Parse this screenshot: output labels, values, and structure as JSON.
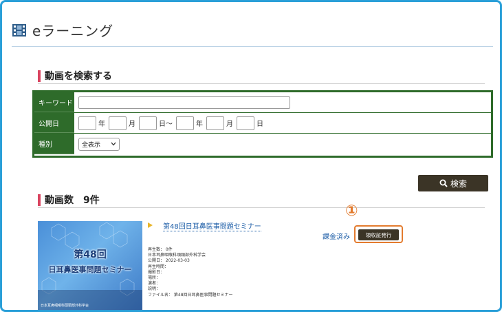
{
  "page": {
    "title": "eラーニング"
  },
  "search_section": {
    "heading": "動画を検索する",
    "form": {
      "keyword_label": "キーワード",
      "keyword_value": "",
      "date_label": "公開日",
      "year_unit": "年",
      "month_unit": "月",
      "day_unit_tilde": "日～",
      "day_unit": "日",
      "category_label": "種別",
      "category_selected": "全表示"
    },
    "search_button_label": "検索"
  },
  "results_section": {
    "heading": "動画数　9件",
    "videos": [
      {
        "title": "第48回日耳鼻医事問題セミナー",
        "thumbnail_line1": "第48回",
        "thumbnail_line2": "日耳鼻医事問題セミナー",
        "thumbnail_footer": "日本耳鼻咽喉科頭頸部外科学会",
        "meta": [
          "再生数： 0件",
          "日本耳鼻咽喉科頭頸部外科学会",
          "公開日： 2022-03-03",
          "再生時間：",
          "撮影日：",
          "場所：",
          "演者：",
          "説明：",
          "ファイル名： 第48回日耳鼻医事問題セミナー"
        ],
        "paid_status": "課金済み",
        "receipt_button_label": "領収証発行"
      }
    ]
  },
  "annotation": {
    "callout_number": "①"
  },
  "colors": {
    "accent_green": "#2e6b2a",
    "button_dark": "#3b3426",
    "heading_bar": "#d9435f",
    "link_blue": "#1f5fa8",
    "callout_orange": "#e37b2e"
  }
}
